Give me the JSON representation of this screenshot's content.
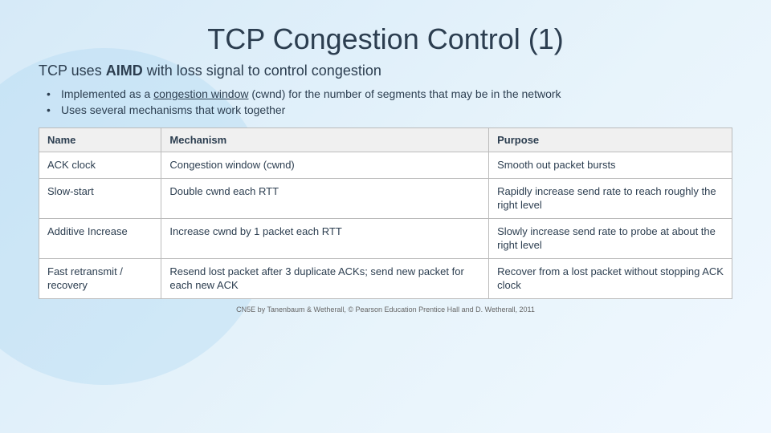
{
  "slide": {
    "title": "TCP Congestion Control (1)",
    "subtitle_plain": "TCP uses ",
    "subtitle_bold": "AIMD",
    "subtitle_rest": " with loss signal to control congestion",
    "bullets": [
      "Implemented as a congestion window (cwnd) for the number of segments that may be in the network",
      "Uses several mechanisms that work together"
    ],
    "table": {
      "headers": [
        "Name",
        "Mechanism",
        "Purpose"
      ],
      "rows": [
        [
          "ACK clock",
          "Congestion window (cwnd)",
          "Smooth out packet bursts"
        ],
        [
          "Slow-start",
          "Double cwnd each RTT",
          "Rapidly increase send rate to reach roughly the right level"
        ],
        [
          "Additive Increase",
          "Increase cwnd by 1 packet each RTT",
          "Slowly increase send rate to probe at about the right level"
        ],
        [
          "Fast retransmit / recovery",
          "Resend lost packet after 3 duplicate ACKs; send new packet for each new ACK",
          "Recover from a lost packet without stopping ACK clock"
        ]
      ]
    },
    "footer": "CN5E by Tanenbaum & Wetherall, © Pearson Education Prentice Hall and D. Wetherall, 2011"
  }
}
